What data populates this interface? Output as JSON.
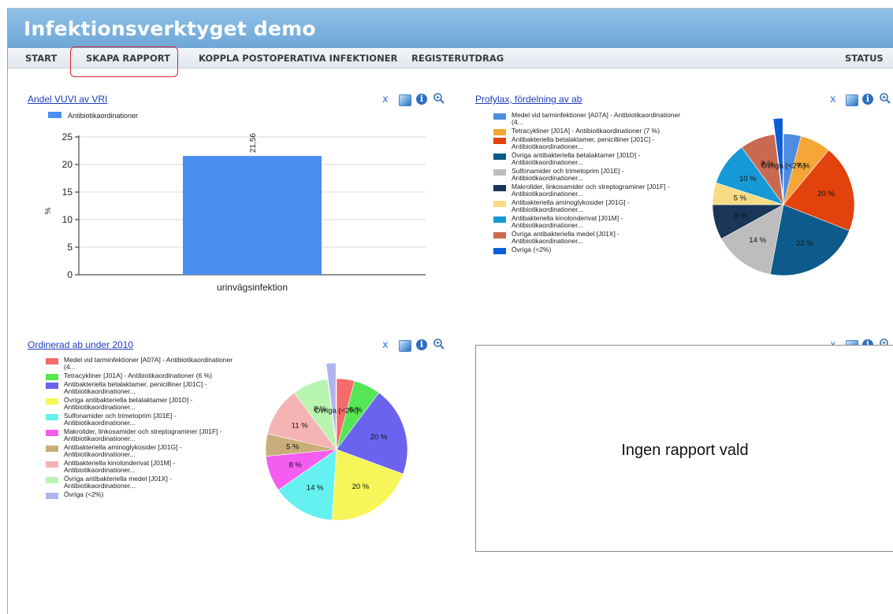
{
  "app": {
    "title": "Infektionsverktyget demo"
  },
  "nav": {
    "start": "START",
    "skapa_rapport": "SKAPA RAPPORT",
    "koppla": "KOPPLA POSTOPERATIVA INFEKTIONER",
    "registerutdrag": "REGISTERUTDRAG",
    "status": "STATUS"
  },
  "toolbar": {
    "x_label": "x",
    "info_label": "i"
  },
  "panels": {
    "vuvi": {
      "title": "Andel VUVI av VRI"
    },
    "profylax": {
      "title": "Profylax, fördelning av ab"
    },
    "ordinerad": {
      "title": "Ordinerad ab under 2010"
    },
    "empty": {
      "message": "Ingen rapport vald"
    }
  },
  "chart_data": [
    {
      "type": "bar",
      "title": "Andel VUVI av VRI",
      "categories": [
        "urinvägsinfektion"
      ],
      "series": [
        {
          "name": "Antibiotikaordinationer",
          "values": [
            21.56
          ]
        }
      ],
      "value_labels": [
        "21,56"
      ],
      "xlabel": "",
      "ylabel": "%",
      "ylim": [
        0,
        25
      ],
      "yticks": [
        0,
        5,
        10,
        15,
        20,
        25
      ],
      "grid": true,
      "legend": "top-left",
      "colors": [
        "#4a8ff0"
      ]
    },
    {
      "type": "pie",
      "title": "Profylax, fördelning av ab",
      "legend": "left",
      "slices": [
        {
          "legend": "Medel vid tarminfektioner [A07A] - Antibiotikaordinationer (4...",
          "value": 4,
          "label": "",
          "color": "#4d8de0"
        },
        {
          "legend": "Tetracykliner [J01A] - Antibiotikaordinationer (7 %)",
          "value": 7,
          "label": "7 %",
          "color": "#f5a637"
        },
        {
          "legend": "Antibakteriella betalaktamer, penicilliner [J01C] - Antibiotikaordinationer...",
          "value": 20,
          "label": "20 %",
          "color": "#e2420c"
        },
        {
          "legend": "Övriga antibakteriella betalaktamer [J01D] - Antibiotikaordinationer...",
          "value": 22,
          "label": "22 %",
          "color": "#0d5b8a"
        },
        {
          "legend": "Sulfonamider och trimetoprim [J01E] - Antibiotikaordinationer...",
          "value": 14,
          "label": "14 %",
          "color": "#bdbdbd"
        },
        {
          "legend": "Makrolider, linkosamider och streptograminer [J01F] - Antibiotikaordinationer...",
          "value": 8,
          "label": "8 %",
          "color": "#1a3658"
        },
        {
          "legend": "Antibakteriella aminoglykosider [J01G] - Antibiotikaordinationer...",
          "value": 5,
          "label": "5 %",
          "color": "#f8dc83"
        },
        {
          "legend": "Antibakteriella kinolonderivat [J01M] - Antibiotikaordinationer...",
          "value": 10,
          "label": "10 %",
          "color": "#1799d6"
        },
        {
          "legend": "Övriga antibakteriella medel [J01X] - Antibiotikaordinationer...",
          "value": 8,
          "label": "8 %",
          "color": "#c96a50"
        },
        {
          "legend": "Övriga (<2%)",
          "value": 2,
          "label": "Övriga (<2%)",
          "color": "#0f5dd6",
          "exploded": true
        }
      ]
    },
    {
      "type": "pie",
      "title": "Ordinerad ab under 2010",
      "legend": "left",
      "slices": [
        {
          "legend": "Medel vid tarminfektioner [A07A] - Antibiotikaordinationer (4...",
          "value": 4,
          "label": "",
          "color": "#f56a6a"
        },
        {
          "legend": "Tetracykliner [J01A] - Antibiotikaordinationer (6 %)",
          "value": 6,
          "label": "6 %",
          "color": "#55e655"
        },
        {
          "legend": "Antibakteriella betalaktamer, penicilliner [J01C] - Antibiotikaordinationer...",
          "value": 20,
          "label": "20 %",
          "color": "#6a63ef"
        },
        {
          "legend": "Övriga antibakteriella betalaktamer [J01D] - Antibiotikaordinationer...",
          "value": 20,
          "label": "20 %",
          "color": "#f6f65a"
        },
        {
          "legend": "Sulfonamider och trimetoprim [J01E] - Antibiotikaordinationer...",
          "value": 14,
          "label": "14 %",
          "color": "#66f1f1"
        },
        {
          "legend": "Makrolider, linkosamider och streptograminer [J01F] - Antibiotikaordinationer...",
          "value": 8,
          "label": "8 %",
          "color": "#f55cf0"
        },
        {
          "legend": "Antibakteriella aminoglykosider [J01G] - Antibiotikaordinationer...",
          "value": 5,
          "label": "5 %",
          "color": "#c9ae7b"
        },
        {
          "legend": "Antibakteriella kinolonderivat [J01M] - Antibiotikaordinationer...",
          "value": 11,
          "label": "11 %",
          "color": "#f5b4b4"
        },
        {
          "legend": "Övriga antibakteriella medel [J01X] - Antibiotikaordinationer...",
          "value": 8,
          "label": "8 %",
          "color": "#b8f5b0"
        },
        {
          "legend": "Övriga (<2%)",
          "value": 2,
          "label": "Övriga (<2%)",
          "color": "#b0b5f0",
          "exploded": true
        }
      ]
    }
  ]
}
